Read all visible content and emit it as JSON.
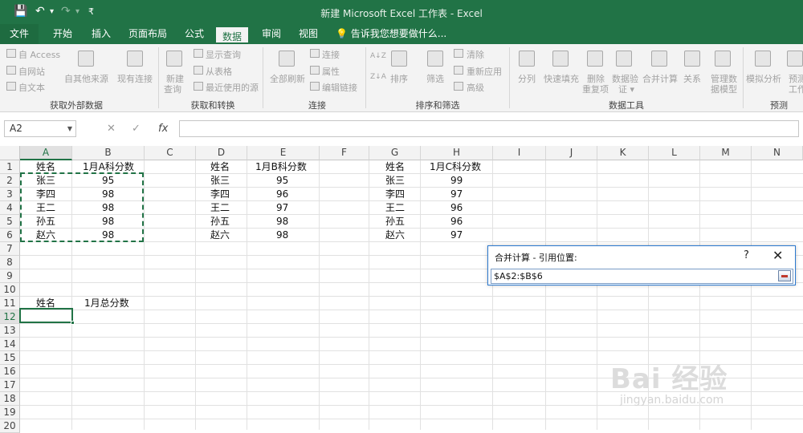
{
  "title": "新建 Microsoft Excel 工作表 - Excel",
  "quick_access": {
    "save": "💾",
    "undo": "↶",
    "undo_dd": "▾",
    "redo": "↷",
    "redo_dd": "▾",
    "customize": "₹"
  },
  "tabs": [
    "文件",
    "开始",
    "插入",
    "页面布局",
    "公式",
    "数据",
    "审阅",
    "视图"
  ],
  "tell_me": "告诉我您想要做什么...",
  "ribbon": {
    "get_external": {
      "access": "自 Access",
      "web": "自网站",
      "text": "自文本",
      "other": "自其他来源",
      "existing": "现有连接",
      "label": "获取外部数据"
    },
    "transform": {
      "new_query": "新建",
      "new_query2": "查询",
      "show_queries": "显示查询",
      "from_table": "从表格",
      "recent": "最近使用的源",
      "label": "获取和转换"
    },
    "connections": {
      "refresh": "全部刷新",
      "conn": "连接",
      "props": "属性",
      "edit_links": "编辑链接",
      "label": "连接"
    },
    "sort_filter": {
      "sort": "排序",
      "filter": "筛选",
      "clear": "清除",
      "reapply": "重新应用",
      "advanced": "高级",
      "label": "排序和筛选",
      "az": "A↓Z",
      "za": "Z↓A"
    },
    "data_tools": {
      "text_cols": "分列",
      "flash": "快速填充",
      "remove_dup": "删除",
      "remove_dup2": "重复项",
      "validation": "数据验",
      "validation2": "证 ▾",
      "consolidate": "合并计算",
      "relations": "关系",
      "model": "管理数",
      "model2": "据模型",
      "label": "数据工具"
    },
    "forecast": {
      "whatif": "模拟分析",
      "sheet": "预测",
      "sheet2": "工作",
      "label": "预测"
    }
  },
  "namebox": "A2",
  "namebox_dd": "▼",
  "fx": {
    "cancel": "✕",
    "enter": "✓",
    "fx": "fx"
  },
  "columns": [
    "A",
    "B",
    "C",
    "D",
    "E",
    "F",
    "G",
    "H",
    "I",
    "J",
    "K",
    "L",
    "M",
    "N"
  ],
  "rows": [
    "1",
    "2",
    "3",
    "4",
    "5",
    "6",
    "7",
    "8",
    "9",
    "10",
    "11",
    "12",
    "13",
    "14",
    "15",
    "16",
    "17",
    "18",
    "19",
    "20"
  ],
  "table_a": {
    "header_name": "姓名",
    "header_score": "1月A科分数",
    "names": [
      "张三",
      "李四",
      "王二",
      "孙五",
      "赵六"
    ],
    "scores": [
      "95",
      "98",
      "98",
      "98",
      "98"
    ]
  },
  "table_b": {
    "header_name": "姓名",
    "header_score": "1月B科分数",
    "names": [
      "张三",
      "李四",
      "王二",
      "孙五",
      "赵六"
    ],
    "scores": [
      "95",
      "96",
      "97",
      "98",
      "98"
    ]
  },
  "table_c": {
    "header_name": "姓名",
    "header_score": "1月C科分数",
    "names": [
      "张三",
      "李四",
      "王二",
      "孙五",
      "赵六"
    ],
    "scores": [
      "99",
      "97",
      "96",
      "96",
      "97"
    ]
  },
  "summary": {
    "header_name": "姓名",
    "header_score": "1月总分数"
  },
  "dialog": {
    "title": "合并计算 - 引用位置:",
    "help": "?",
    "close": "✕",
    "reference": "$A$2:$B$6"
  },
  "watermark": {
    "logo": "Bai  经验",
    "url": "jingyan.baidu.com"
  },
  "colors": {
    "excel_green": "#217346",
    "ribbon_bg": "#f3f3f3"
  }
}
